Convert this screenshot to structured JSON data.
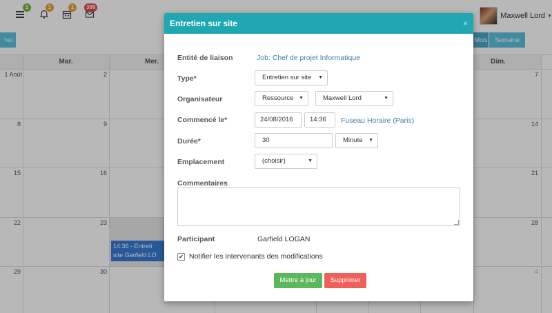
{
  "topbar": {
    "badges": [
      "1",
      "1",
      "1",
      "399"
    ],
    "user_name": "Maxwell Lord",
    "colors": {
      "green": "#7cb342",
      "orange": "#e5a23b",
      "red": "#e04a4a"
    }
  },
  "calendar": {
    "today_btn": "'hui",
    "month_btn": "Mois",
    "week_btn": "Semaine",
    "day_headers": [
      "Mar.",
      "Mer.",
      "Dim."
    ],
    "day_numbers": [
      "1 Août",
      "2",
      "7",
      "8",
      "9",
      "14",
      "15",
      "16",
      "21",
      "22",
      "23",
      "28",
      "29",
      "30",
      "4"
    ],
    "event_line1": "14:36 - Entreti",
    "event_line2_prefix": "site ",
    "event_line2_name": "Garfield LO"
  },
  "modal": {
    "title": "Entretien sur site",
    "close_icon": "×",
    "entity_label": "Entité de liaison",
    "entity_value": "Job: Chef de projet Informatique",
    "type_label": "Type*",
    "type_value": "Entretien sur site",
    "organizer_label": "Organisateur",
    "organizer_kind": "Ressource",
    "organizer_name": "Maxwell Lord",
    "start_label": "Commencé le*",
    "start_date": "24/08/2016",
    "start_time": "14:36",
    "timezone": "Fuseau Horaire (Paris)",
    "duration_label": "Durée*",
    "duration_value": "30",
    "duration_unit": "Minute",
    "location_label": "Emplacement",
    "location_value": "(choisir)",
    "comments_label": "Commentaires",
    "comments_value": "",
    "participant_label": "Participant",
    "participant_value": "Garfield LOGAN",
    "notify_checked": true,
    "notify_label": "Notifier les intervenants des modifications",
    "update_button": "Mettre à jour",
    "delete_button": "Supprimer",
    "colors": {
      "header": "#1fa8b4",
      "update": "#5cb85c",
      "delete": "#f0605a",
      "link": "#3f7fa8"
    }
  }
}
